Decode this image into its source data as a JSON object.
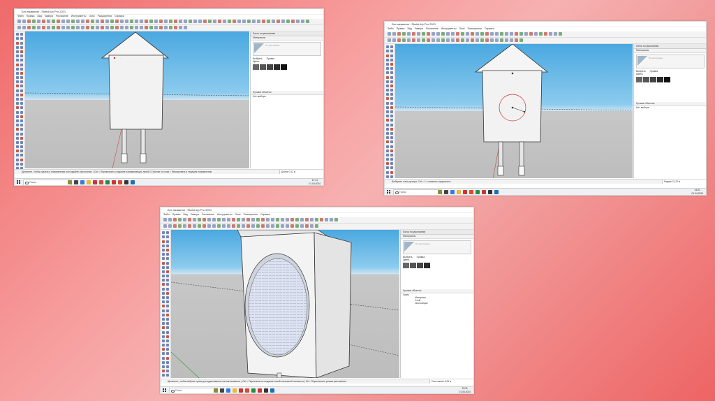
{
  "background": {
    "colors": [
      "#f06a6a",
      "#f7b1b1",
      "#ee6464"
    ]
  },
  "screens": [
    {
      "window_title": "Без названия - SketchUp Pro 2021",
      "menu": [
        "Файл",
        "Правка",
        "Вид",
        "Камера",
        "Рисование",
        "Инструменты",
        "Окно",
        "Расширения",
        "Справка"
      ],
      "panel_title": "Лоток по умолчанию",
      "panel_sections": {
        "materials": "Материалы",
        "components": "Лучшие объекты"
      },
      "material_name": "По умолчанию",
      "tabs": [
        "Выбрать",
        "Правка"
      ],
      "swatch_label": "Цвета",
      "components_text": "Нет выбора",
      "status_text": "Щелкните, чтобы указать в направлении или задайте расстояние. | Ctrl = Переключить создание направляющих линий | Стрелки по осям = Фиксировать в текущем направлении",
      "measurement": "Длина  0,12 м",
      "taskbar_search": "Поиск",
      "time": "17:14",
      "date": "01.04.2024"
    },
    {
      "window_title": "Без названия - SketchUp Pro 2021",
      "menu": [
        "Файл",
        "Правка",
        "Вид",
        "Камера",
        "Рисование",
        "Инструменты",
        "Окно",
        "Расширения",
        "Справка"
      ],
      "panel_title": "Лоток по умолчанию",
      "panel_sections": {
        "materials": "Материалы",
        "components": "Лучшие объекты"
      },
      "material_name": "По умолчанию",
      "tabs": [
        "Выбрать",
        "Правка"
      ],
      "swatch_label": "Цвета",
      "components_text": "Нет выбора",
      "status_text": "Выберите точку центра. Ctrl = +/- сегменты окружности",
      "measurement": "Радиус  0,121 м",
      "taskbar_search": "Поиск",
      "time": "23:21",
      "date": "01.04.2024"
    },
    {
      "window_title": "Без названия - SketchUp Pro 2021",
      "menu": [
        "Файл",
        "Правка",
        "Вид",
        "Камера",
        "Рисование",
        "Инструменты",
        "Окно",
        "Расширения",
        "Справка"
      ],
      "panel_title": "Лоток по умолчанию",
      "panel_sections": {
        "materials": "Материалы",
        "components": "Лучшие объекты"
      },
      "material_name": "По умолчанию",
      "tabs": [
        "Выбрать",
        "Правка"
      ],
      "swatch_label": "Цвета",
      "components_text": "Грань",
      "face_fields": [
        "Материал",
        "Слой",
        "Экспозиция"
      ],
      "status_text": "Щелкните, чтобы выбрать грань для вдавливания или вытягивания. | Ctrl = Переключить создание новой начальной плоскости | Alt = Переключить режим растяжения",
      "measurement": "Расстояние  0,06 м",
      "taskbar_search": "Поиск",
      "time": "23:31",
      "date": "01.04.2024"
    }
  ]
}
